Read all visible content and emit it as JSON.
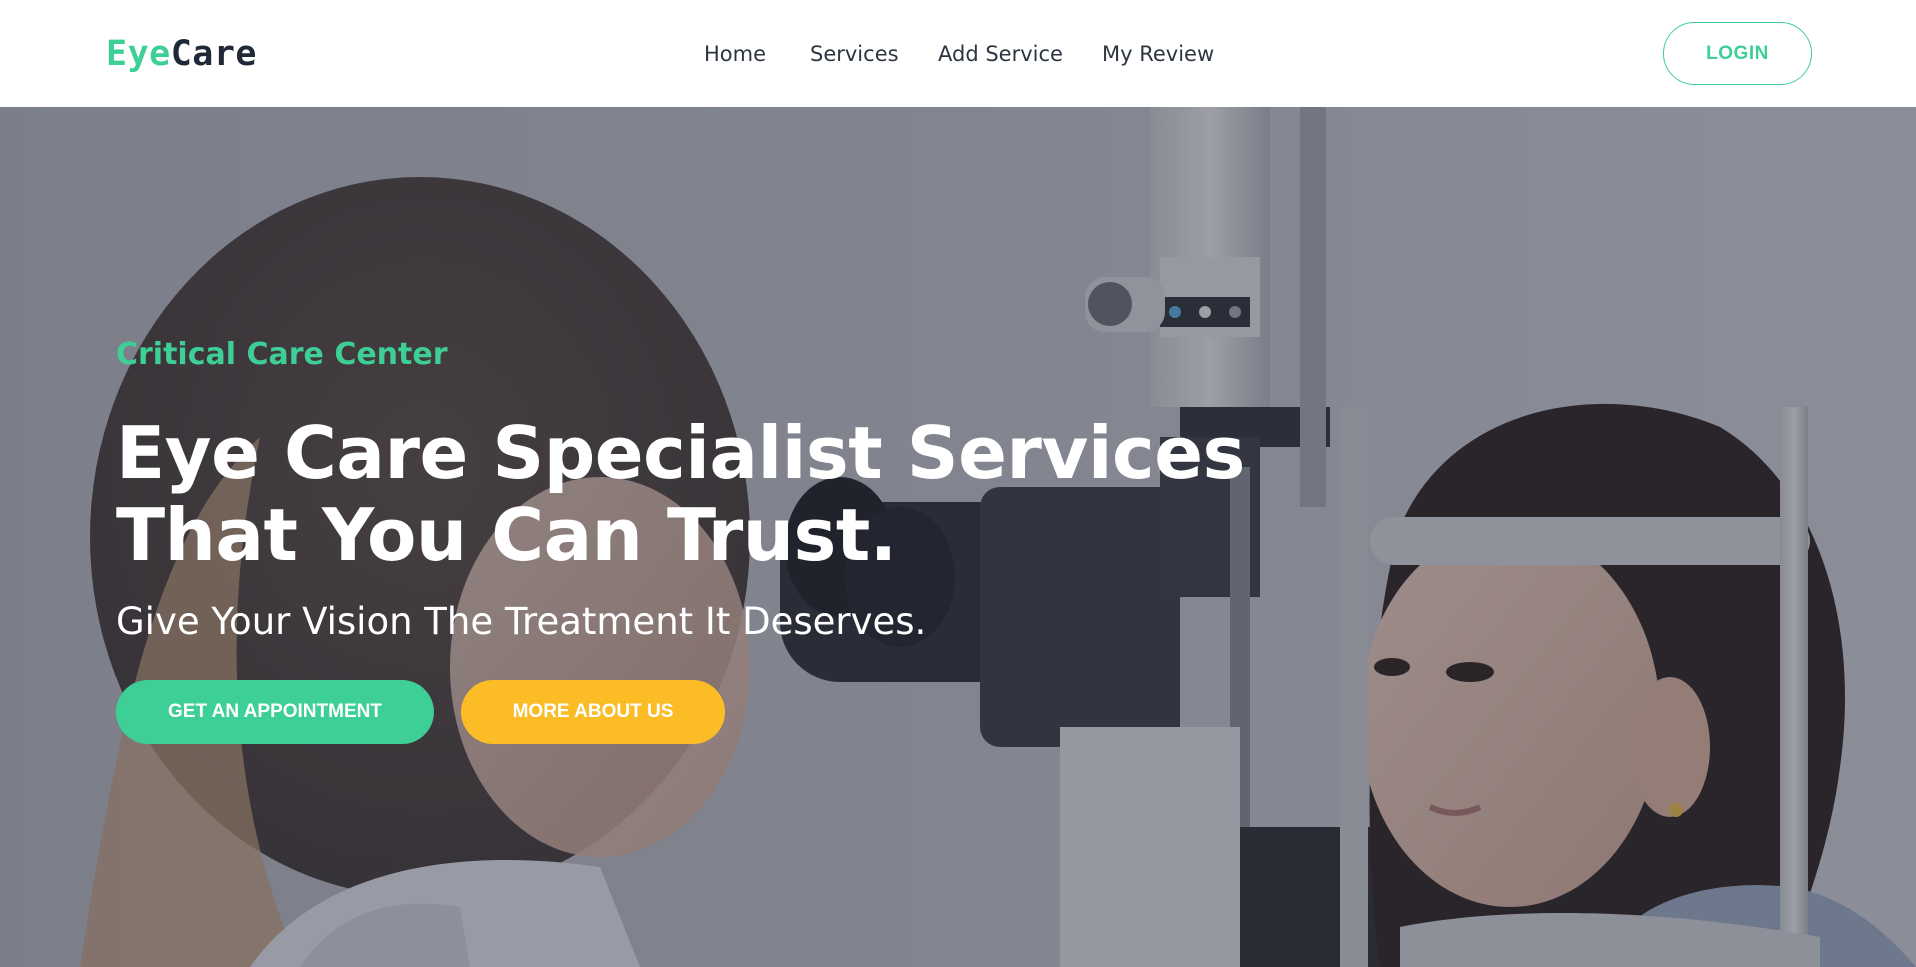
{
  "brand": {
    "part1": "Eye",
    "part2": "Care"
  },
  "nav": {
    "items": [
      {
        "label": "Home"
      },
      {
        "label": "Services"
      },
      {
        "label": "Add Service"
      },
      {
        "label": "My Review"
      }
    ],
    "login_label": "LOGIN"
  },
  "hero": {
    "eyebrow": "Critical Care Center",
    "headline_line1": "Eye Care Specialist Services",
    "headline_line2": "That You Can Trust.",
    "subheadline": "Give Your Vision The Treatment It Deserves.",
    "primary_button": "GET AN APPOINTMENT",
    "secondary_button": "MORE ABOUT US"
  },
  "colors": {
    "accent_green": "#3ecf96",
    "accent_yellow": "#fbbc26",
    "text_dark": "#1f2937",
    "overlay": "rgba(40,44,60,0.42)"
  },
  "icons": []
}
